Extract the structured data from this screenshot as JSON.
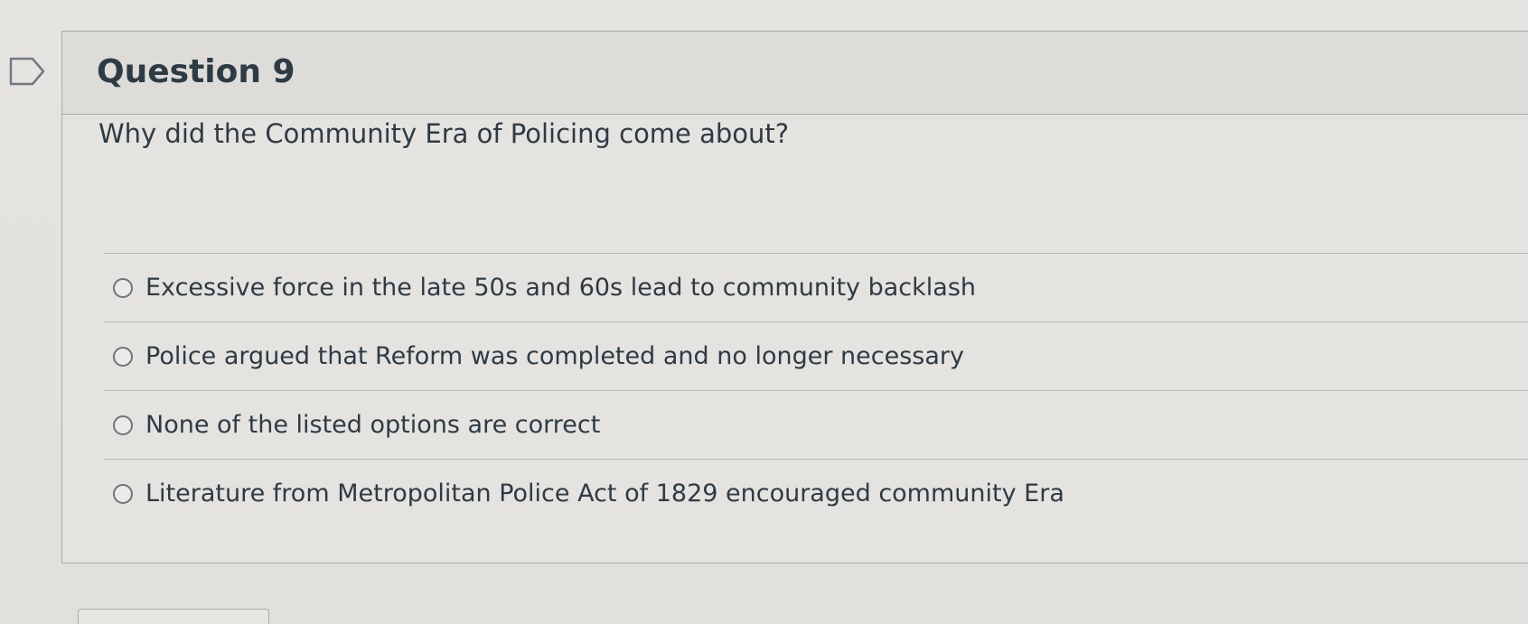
{
  "question": {
    "title": "Question 9",
    "text": "Why did the Community Era of Policing come about?",
    "answers": [
      {
        "label": "Excessive force in the late 50s and 60s lead to community backlash",
        "selected": false
      },
      {
        "label": "Police argued that Reform was completed and no longer necessary",
        "selected": false
      },
      {
        "label": "None of the listed options are correct",
        "selected": false
      },
      {
        "label": "Literature from Metropolitan Police Act of 1829 encouraged community Era",
        "selected": false
      }
    ]
  },
  "icons": {
    "flag": "flag-question-icon"
  },
  "colors": {
    "text": "#2d3b45",
    "border": "#a9aaab",
    "header_bg": "#dedcd8",
    "page_bg": "#e4e2df"
  }
}
